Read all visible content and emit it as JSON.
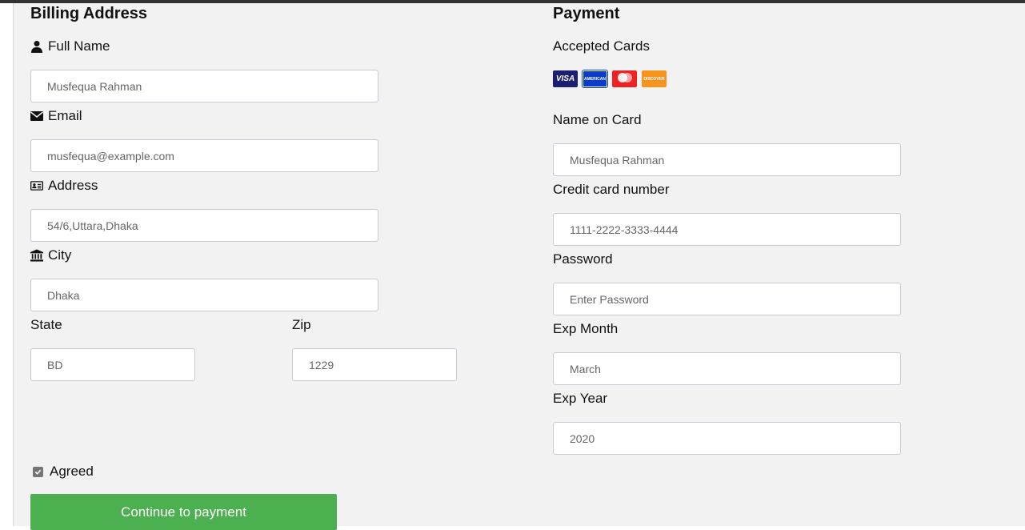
{
  "billing": {
    "heading": "Billing Address",
    "full_name_label": "Full Name",
    "full_name_placeholder": "Musfequa Rahman",
    "email_label": "Email",
    "email_placeholder": "musfequa@example.com",
    "address_label": "Address",
    "address_placeholder": "54/6,Uttara,Dhaka",
    "city_label": "City",
    "city_placeholder": "Dhaka",
    "state_label": "State",
    "state_placeholder": "BD",
    "zip_label": "Zip",
    "zip_placeholder": "1229"
  },
  "payment": {
    "heading": "Payment",
    "accepted_cards_label": "Accepted Cards",
    "cards": [
      "visa-card-icon",
      "amex-card-icon",
      "mastercard-card-icon",
      "discover-card-icon"
    ],
    "name_on_card_label": "Name on Card",
    "name_on_card_placeholder": "Musfequa Rahman",
    "card_number_label": "Credit card number",
    "card_number_placeholder": "1111-2222-3333-4444",
    "password_label": "Password",
    "password_placeholder": "Enter Password",
    "exp_month_label": "Exp Month",
    "exp_month_placeholder": "March",
    "exp_year_label": "Exp Year",
    "exp_year_placeholder": "2020"
  },
  "agreement": {
    "label": "Agreed",
    "checked": true
  },
  "submit_label": "Continue to payment",
  "colors": {
    "button": "#4caf50",
    "panel_bg": "#f2f2f2"
  }
}
